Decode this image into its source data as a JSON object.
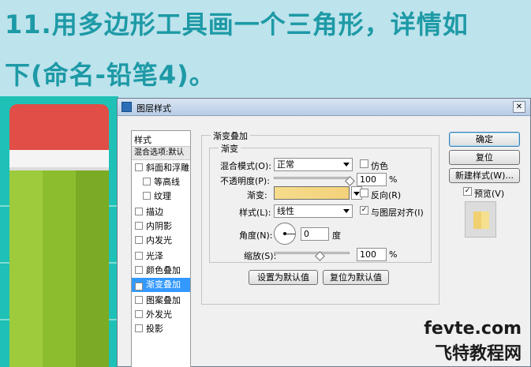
{
  "header": {
    "line1": "11.用多边形工具画一个三角形，详情如",
    "line2": "下(命名-铅笔4)。"
  },
  "dialog": {
    "title": "图层样式",
    "close_icon": "close-icon",
    "styles_header": "样式",
    "blend_options": "混合选项:默认",
    "style_items": [
      {
        "label": "斜面和浮雕",
        "checked": false
      },
      {
        "label": "等高线",
        "checked": false
      },
      {
        "label": "纹理",
        "checked": false
      },
      {
        "label": "描边",
        "checked": false
      },
      {
        "label": "内阴影",
        "checked": false
      },
      {
        "label": "内发光",
        "checked": false
      },
      {
        "label": "光泽",
        "checked": false
      },
      {
        "label": "颜色叠加",
        "checked": false
      },
      {
        "label": "渐变叠加",
        "checked": true,
        "selected": true
      },
      {
        "label": "图案叠加",
        "checked": false
      },
      {
        "label": "外发光",
        "checked": false
      },
      {
        "label": "投影",
        "checked": false
      }
    ],
    "outer_group": "渐变叠加",
    "inner_group": "渐变",
    "blend_mode_label": "混合模式(O):",
    "blend_mode_value": "正常",
    "dither_label": "仿色",
    "opacity_label": "不透明度(P):",
    "opacity_value": "100",
    "percent": "%",
    "gradient_label": "渐变:",
    "gradient_colors": [
      "#f6dc8c",
      "#f3d27a"
    ],
    "reverse_label": "反向(R)",
    "style_label": "样式(L):",
    "style_value": "线性",
    "align_label": "与图层对齐(I)",
    "align_checked": true,
    "angle_label": "角度(N):",
    "angle_value": "0",
    "degree": "度",
    "scale_label": "缩放(S):",
    "scale_value": "100",
    "scale_percent": "%",
    "make_default": "设置为默认值",
    "reset_default": "复位为默认值",
    "ok": "确定",
    "reset": "复位",
    "new_style": "新建样式(W)...",
    "preview_label": "预览(V)",
    "preview_checked": true
  },
  "watermark": {
    "line1": "fevte.com",
    "line2": "飞特教程网"
  },
  "colors": {
    "title_text": "#1d9aa6",
    "bg": "#bde3ec",
    "art_bg": "#1fc1b6",
    "eraser": "#e04e47",
    "pencil_green": "#9dcb3c",
    "selection": "#3399ff"
  }
}
